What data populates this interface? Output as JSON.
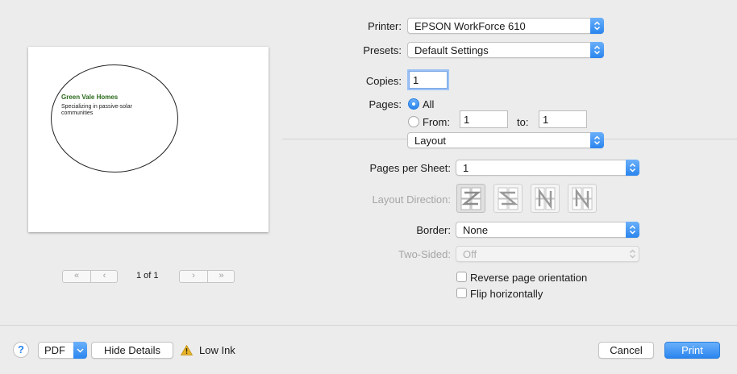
{
  "printer": {
    "label": "Printer:",
    "value": "EPSON WorkForce 610"
  },
  "presets": {
    "label": "Presets:",
    "value": "Default Settings"
  },
  "copies": {
    "label": "Copies:",
    "value": "1"
  },
  "pages": {
    "label": "Pages:",
    "all_label": "All",
    "from_label": "From:",
    "from_value": "1",
    "to_label": "to:",
    "to_value": "1"
  },
  "section": {
    "value": "Layout"
  },
  "pages_per_sheet": {
    "label": "Pages per Sheet:",
    "value": "1"
  },
  "layout_direction": {
    "label": "Layout Direction:",
    "options": [
      "Z",
      "S",
      "N",
      "N"
    ]
  },
  "border": {
    "label": "Border:",
    "value": "None"
  },
  "two_sided": {
    "label": "Two-Sided:",
    "value": "Off"
  },
  "reverse_orientation": {
    "label": "Reverse page orientation",
    "checked": false
  },
  "flip_horizontally": {
    "label": "Flip horizontally",
    "checked": false
  },
  "preview": {
    "company": "Green Vale Homes",
    "tagline_line1": "Specializing in passive-solar",
    "tagline_line2": "communities",
    "page_indicator": "1 of 1",
    "company_color": "#2a6a1b"
  },
  "footer": {
    "help": "?",
    "pdf": "PDF",
    "hide_details": "Hide Details",
    "low_ink": "Low Ink",
    "cancel": "Cancel",
    "print": "Print"
  },
  "colors": {
    "accent": "#2a85ee",
    "warning": "#e8b32a"
  }
}
